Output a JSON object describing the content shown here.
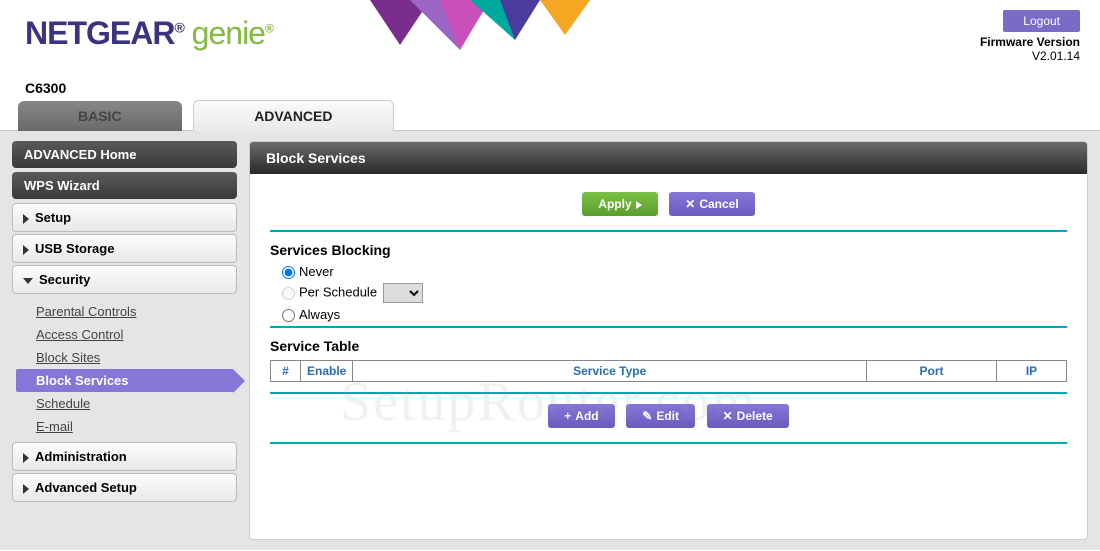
{
  "header": {
    "brand1": "NETGEAR",
    "brand2": "genie",
    "model": "C6300",
    "logout": "Logout",
    "firmware_label": "Firmware Version",
    "firmware_version": "V2.01.14"
  },
  "tabs": {
    "basic": "BASIC",
    "advanced": "ADVANCED"
  },
  "sidebar": {
    "home": "ADVANCED Home",
    "wps": "WPS Wizard",
    "setup": "Setup",
    "usb": "USB Storage",
    "security": "Security",
    "security_items": [
      "Parental Controls",
      "Access Control",
      "Block Sites",
      "Block Services",
      "Schedule",
      "E-mail"
    ],
    "admin": "Administration",
    "advsetup": "Advanced Setup"
  },
  "panel": {
    "title": "Block Services",
    "apply": "Apply",
    "cancel": "Cancel",
    "blocking_label": "Services Blocking",
    "opt_never": "Never",
    "opt_per_schedule": "Per Schedule",
    "opt_always": "Always",
    "selected_blocking": "Never",
    "table_label": "Service Table",
    "cols": {
      "num": "#",
      "enable": "Enable",
      "type": "Service Type",
      "port": "Port",
      "ip": "IP"
    },
    "rows": [],
    "add": "Add",
    "edit": "Edit",
    "delete": "Delete"
  },
  "active_sub_index": 3,
  "watermark": "SetupRouter.com"
}
